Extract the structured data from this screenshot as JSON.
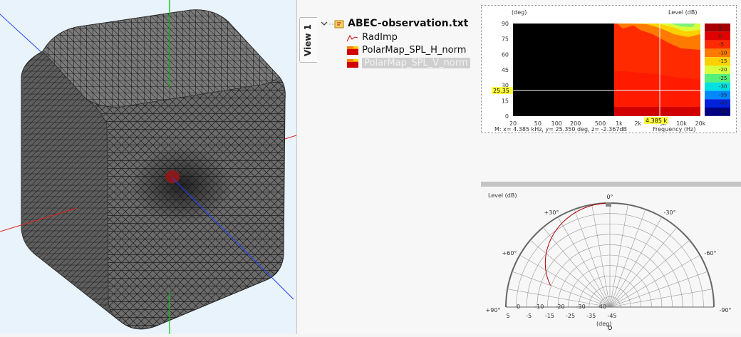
{
  "view_tab": {
    "label": "View 1"
  },
  "tree": {
    "root_label": "ABEC-observation.txt",
    "items": [
      {
        "label": "RadImp",
        "icon": "line-graph-icon"
      },
      {
        "label": "PolarMap_SPL_H_norm",
        "icon": "heatmap-icon"
      },
      {
        "label": "PolarMap_SPL_V_norm",
        "icon": "heatmap-icon",
        "selected": true
      }
    ]
  },
  "polar_map": {
    "y_unit_label": "(deg)",
    "level_label": "Level  (dB)",
    "y_ticks": [
      "90",
      "75",
      "60",
      "45",
      "30",
      "15",
      "0"
    ],
    "x_ticks": [
      "20",
      "50",
      "100",
      "200",
      "500",
      "1k",
      "2k",
      "5k",
      "10k",
      "20k"
    ],
    "cursor_y_label": "25.35",
    "cursor_x_label": "4.385 k",
    "x_axis_label": "Frequency  (Hz)",
    "readout": "M:  x= 4.385 kHz,  y= 25.350 deg,  z= -2.367dB",
    "color_scale_ticks": [
      "5",
      "0",
      "-5",
      "-10",
      "-15",
      "-20",
      "-25",
      "-30",
      "-35",
      "-40",
      "-45"
    ],
    "colors": [
      "#a60000",
      "#e00000",
      "#ff2a00",
      "#ff7a00",
      "#ffd000",
      "#d8ff3a",
      "#55f07a",
      "#00e0e0",
      "#0088ff",
      "#0022dd",
      "#000080"
    ]
  },
  "polar_plot": {
    "level_label": "Level  (dB)",
    "angle_labels": [
      "0°",
      "+30°",
      "-30°",
      "+60°",
      "-60°",
      "+90°",
      "-90°"
    ],
    "radial_labels": [
      "5",
      "0",
      "-5",
      "-10",
      "-15",
      "-20",
      "-25",
      "-30",
      "-35",
      "-40",
      "-45"
    ],
    "unit_label": "(deg)"
  },
  "colors": {
    "curve": "#b00000",
    "crosshair": "#ffffff",
    "cursor_label_bg": "#ffff40"
  }
}
